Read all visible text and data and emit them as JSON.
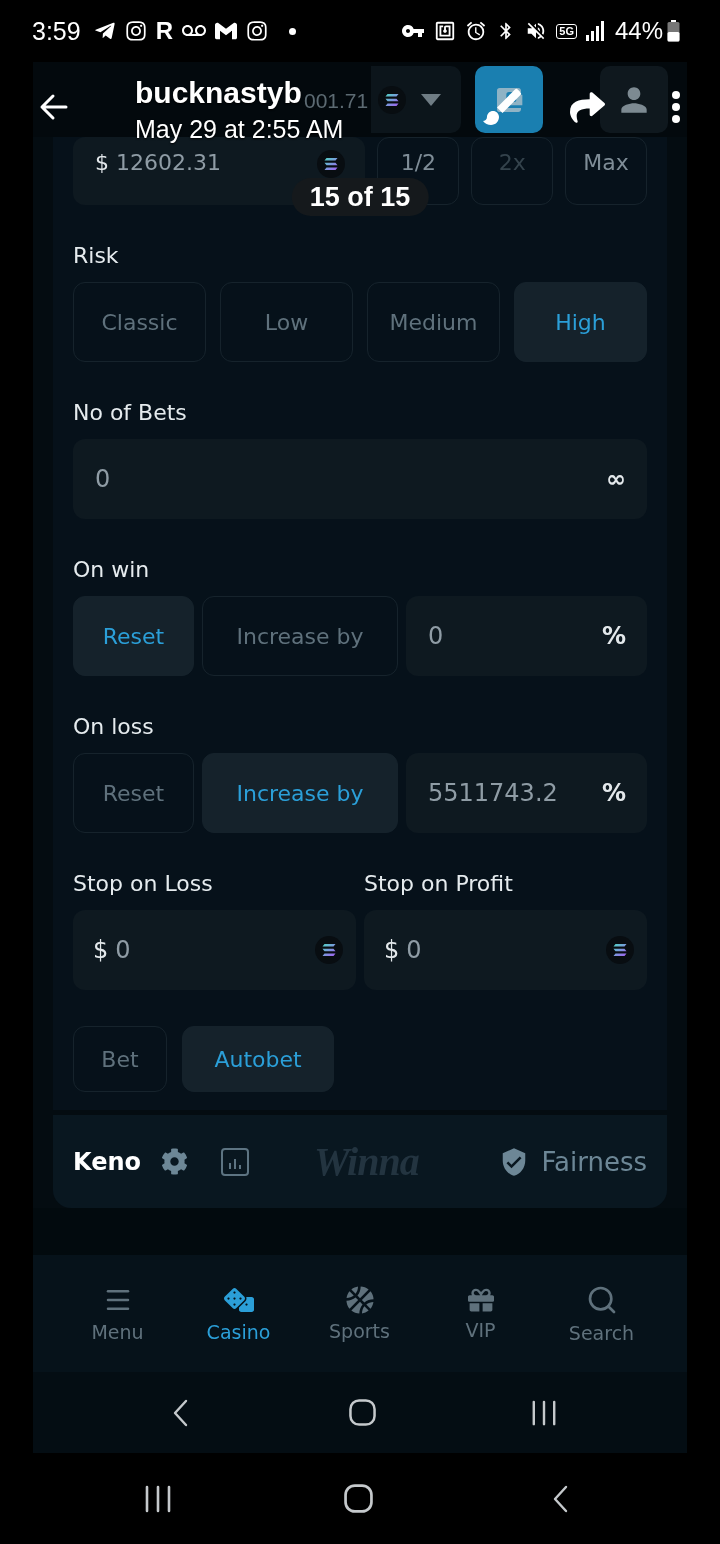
{
  "status_bar": {
    "time": "3:59",
    "app_letter": "R",
    "network": "5G",
    "battery": "44%"
  },
  "viewer": {
    "title": "bucknastyb",
    "subtitle": "May 29 at 2:55 AM",
    "counter": "15 of 15"
  },
  "app_header": {
    "balance": "001.71"
  },
  "bet_amount": {
    "currency": "$",
    "value": "12602.31",
    "buttons": [
      {
        "label": "1/2",
        "disabled": false
      },
      {
        "label": "2x",
        "disabled": true
      },
      {
        "label": "Max",
        "disabled": false
      }
    ]
  },
  "risk": {
    "label": "Risk",
    "options": [
      {
        "label": "Classic",
        "selected": false
      },
      {
        "label": "Low",
        "selected": false
      },
      {
        "label": "Medium",
        "selected": false
      },
      {
        "label": "High",
        "selected": true
      }
    ]
  },
  "bets": {
    "label": "No of Bets",
    "value": "0",
    "suffix": "∞"
  },
  "on_win": {
    "label": "On win",
    "options": [
      {
        "label": "Reset",
        "selected": true
      },
      {
        "label": "Increase by",
        "selected": false
      }
    ],
    "value": "0",
    "suffix": "%"
  },
  "on_loss": {
    "label": "On loss",
    "options": [
      {
        "label": "Reset",
        "selected": false
      },
      {
        "label": "Increase by",
        "selected": true
      }
    ],
    "value": "5511743.2",
    "suffix": "%"
  },
  "stops": [
    {
      "label": "Stop on Loss",
      "currency": "$",
      "value": "0"
    },
    {
      "label": "Stop on Profit",
      "currency": "$",
      "value": "0"
    }
  ],
  "modes": [
    {
      "label": "Bet",
      "selected": false
    },
    {
      "label": "Autobet",
      "selected": true
    }
  ],
  "game_bar": {
    "title": "Keno",
    "logo": "Winna",
    "fairness": "Fairness"
  },
  "bottom_nav": [
    {
      "label": "Menu",
      "selected": false
    },
    {
      "label": "Casino",
      "selected": true
    },
    {
      "label": "Sports",
      "selected": false
    },
    {
      "label": "VIP",
      "selected": false
    },
    {
      "label": "Search",
      "selected": false
    }
  ]
}
